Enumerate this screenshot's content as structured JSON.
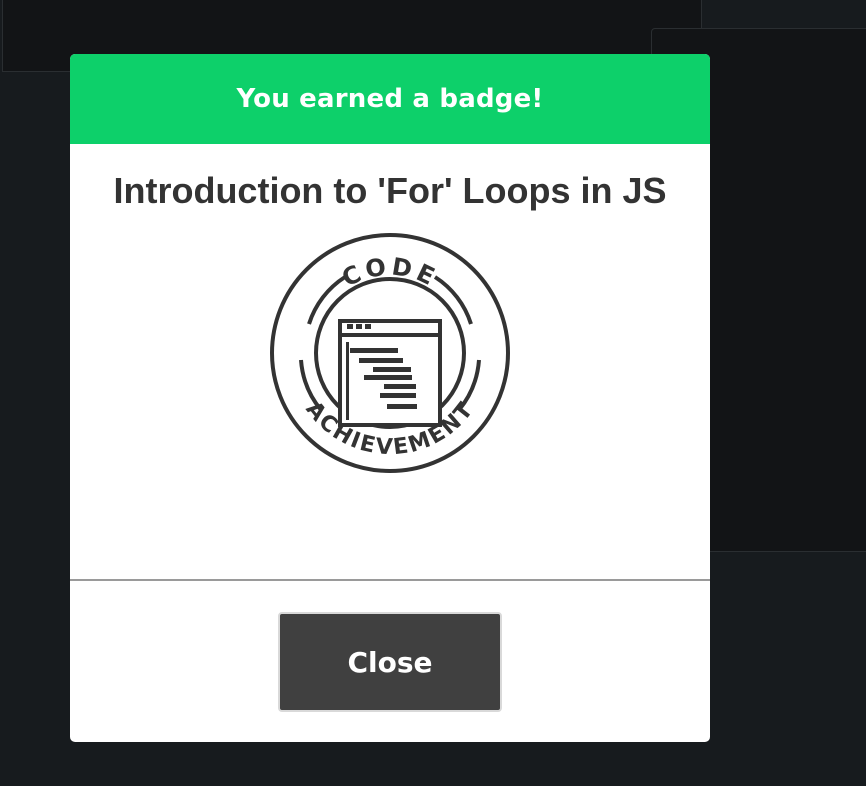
{
  "modal": {
    "header_text": "You earned a badge!",
    "badge_title": "Introduction to 'For' Loops in JS",
    "badge": {
      "icon": "code-achievement-badge",
      "top_text": "CODE",
      "bottom_text": "ACHIEVEMENT"
    },
    "close_label": "Close"
  },
  "colors": {
    "header_green": "#0dd06a",
    "button_dark": "#404040",
    "background": "#171b1e"
  }
}
